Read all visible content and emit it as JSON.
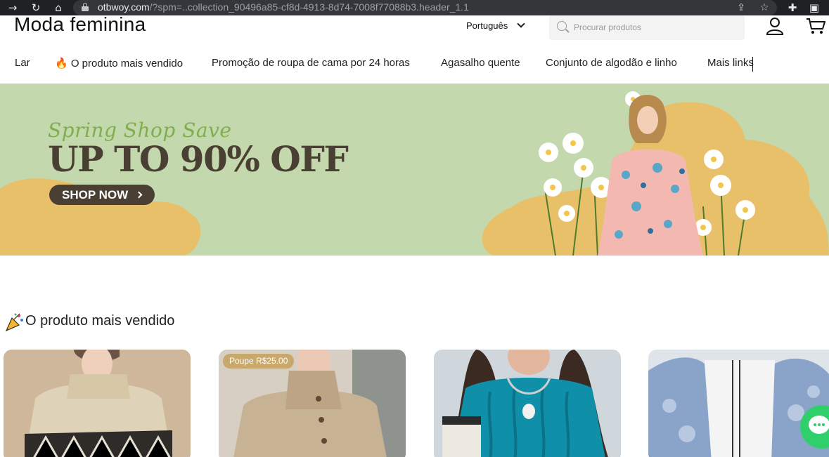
{
  "browser": {
    "url_host": "otbwoy.com",
    "url_rest": "/?spm=..collection_90496a85-cf8d-4913-8d74-7008f77088b3.header_1.1"
  },
  "header": {
    "brand": "Moda feminina",
    "language": "Português",
    "search_placeholder": "Procurar produtos"
  },
  "menu": {
    "items": [
      {
        "label": "Lar"
      },
      {
        "label": "🔥 O produto mais vendido"
      },
      {
        "label": "Promoção de roupa de cama por 24 horas"
      },
      {
        "label": "Agasalho quente"
      },
      {
        "label": "Conjunto de algodão e linho"
      },
      {
        "label": "Mais links"
      }
    ]
  },
  "banner": {
    "script_text": "Spring Shop Save",
    "headline": "UP TO 90% OFF",
    "cta": "SHOP NOW"
  },
  "section": {
    "title": "O produto mais vendido"
  },
  "products": [
    {
      "badge": ""
    },
    {
      "badge": "Poupe R$25.00"
    },
    {
      "badge": ""
    },
    {
      "badge": ""
    }
  ]
}
